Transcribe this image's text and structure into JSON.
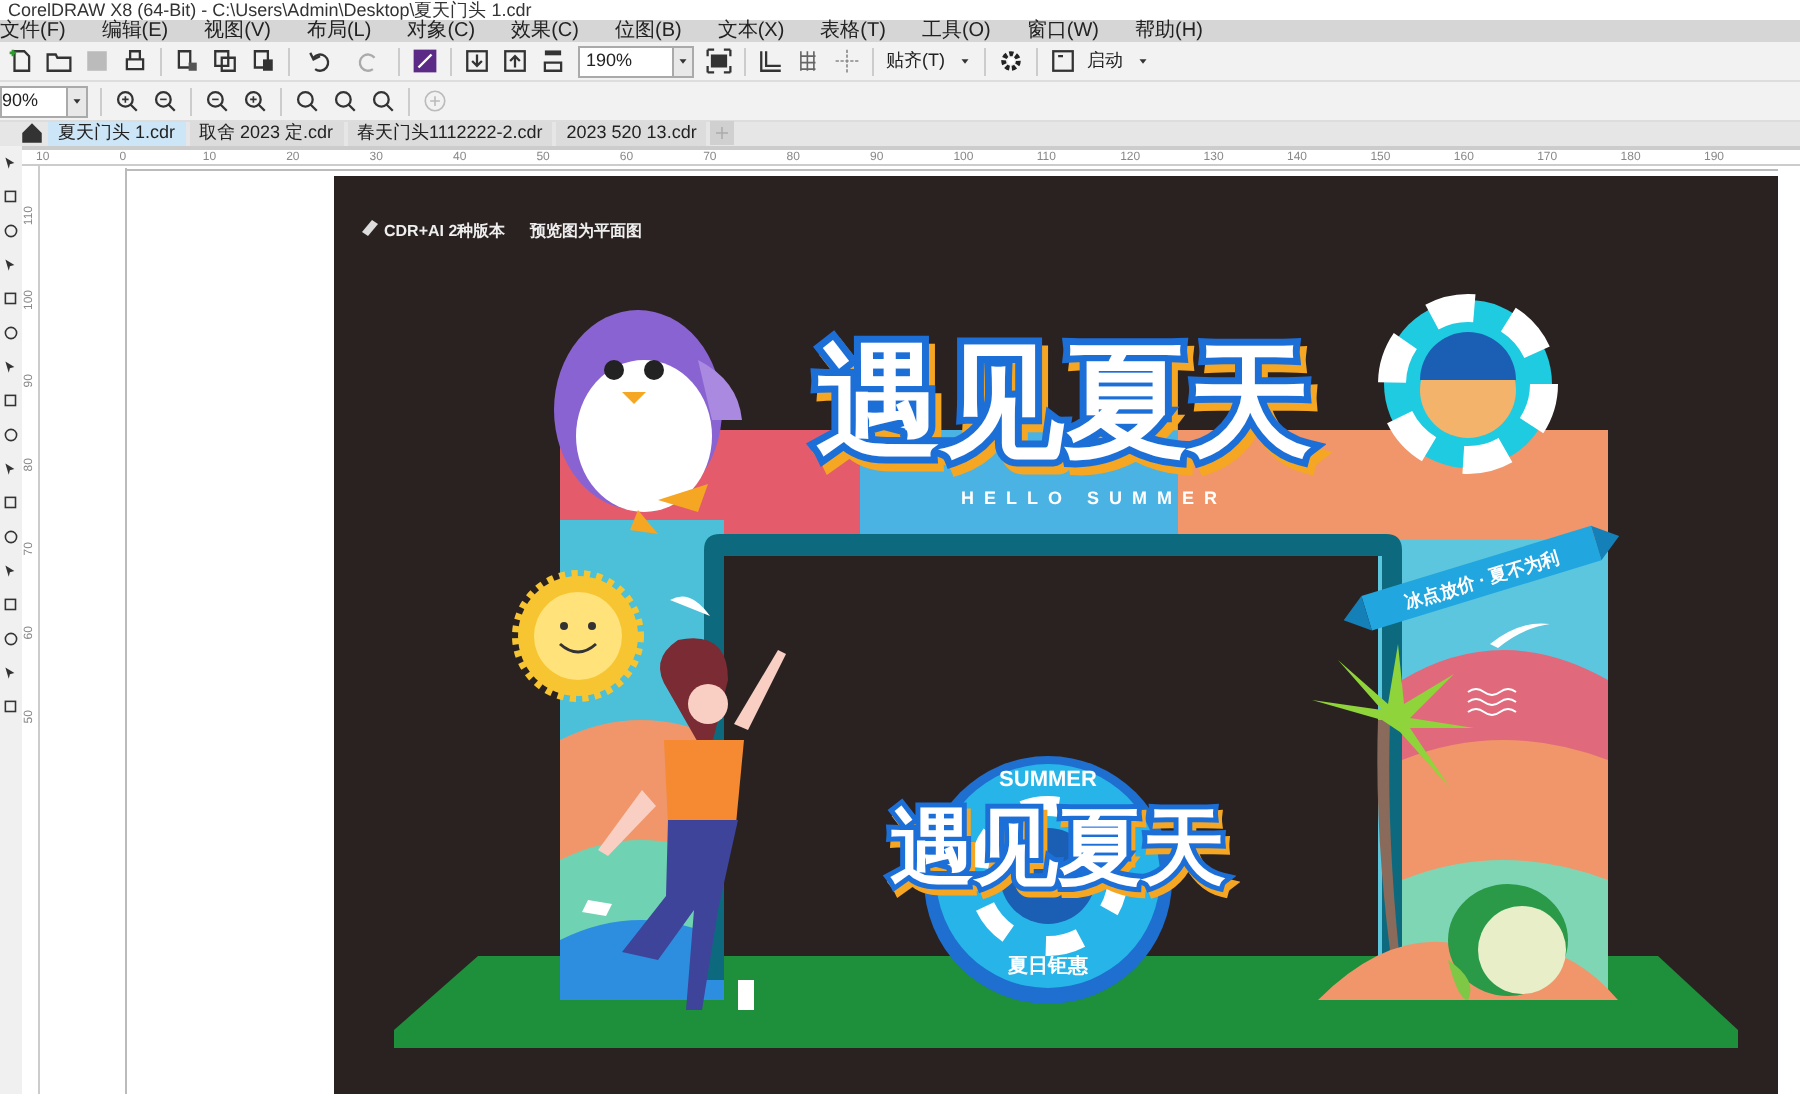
{
  "window": {
    "title": "CorelDRAW X8 (64-Bit) - C:\\Users\\Admin\\Desktop\\夏天门头 1.cdr"
  },
  "menu": [
    "文件(F)",
    "编辑(E)",
    "视图(V)",
    "布局(L)",
    "对象(C)",
    "效果(C)",
    "位图(B)",
    "文本(X)",
    "表格(T)",
    "工具(O)",
    "窗口(W)",
    "帮助(H)"
  ],
  "toolbar": {
    "zoom": "190%",
    "snap": "贴齐(T)",
    "launch": "启动"
  },
  "property_bar": {
    "zoom": "90%"
  },
  "tabs": [
    {
      "label": "夏天门头 1.cdr",
      "selected": true
    },
    {
      "label": "取舍 2023 定.cdr",
      "selected": false
    },
    {
      "label": "春天门头1112222-2.cdr",
      "selected": false
    },
    {
      "label": "2023 520 13.cdr",
      "selected": false
    }
  ],
  "rulers": {
    "horizontal": [
      "10",
      "0",
      "10",
      "20",
      "30",
      "40",
      "50",
      "60",
      "70",
      "80",
      "90",
      "100",
      "110",
      "120",
      "130",
      "140",
      "150",
      "160",
      "170",
      "180",
      "190"
    ],
    "vertical": [
      "110",
      "100",
      "90",
      "80",
      "70",
      "60",
      "50"
    ]
  },
  "artwork": {
    "note_1": "CDR+AI 2种版本",
    "note_2": "预览图为平面图",
    "title": "遇见夏天",
    "subtitle": "HELLO SUMMER",
    "banner": "冰点放价 · 夏不为利",
    "badge_top": "SUMMER",
    "badge_title": "遇见夏天",
    "badge_bottom": "夏日钜惠"
  }
}
